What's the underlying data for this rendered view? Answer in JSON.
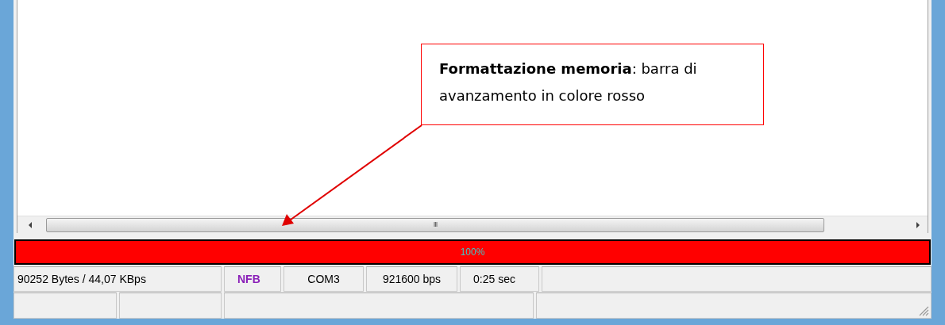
{
  "callout": {
    "text": "**Formattazione memoria**: barra di avanzamento in colore rosso"
  },
  "horizontal_scrollbar": {
    "grip": "III"
  },
  "progress": {
    "level": 1,
    "reading": "100%"
  },
  "status_bar": [
    {
      "text": "90252 Bytes / 44,07 KBps",
      "color": "#000000"
    },
    {
      "text": "NFB",
      "color": "#8a1fb8"
    },
    {
      "text": "COM3",
      "color": "#000000"
    },
    {
      "text": "921600 bps",
      "color": "#000000"
    },
    {
      "text": "0:25 sec",
      "color": "#000000"
    }
  ]
}
